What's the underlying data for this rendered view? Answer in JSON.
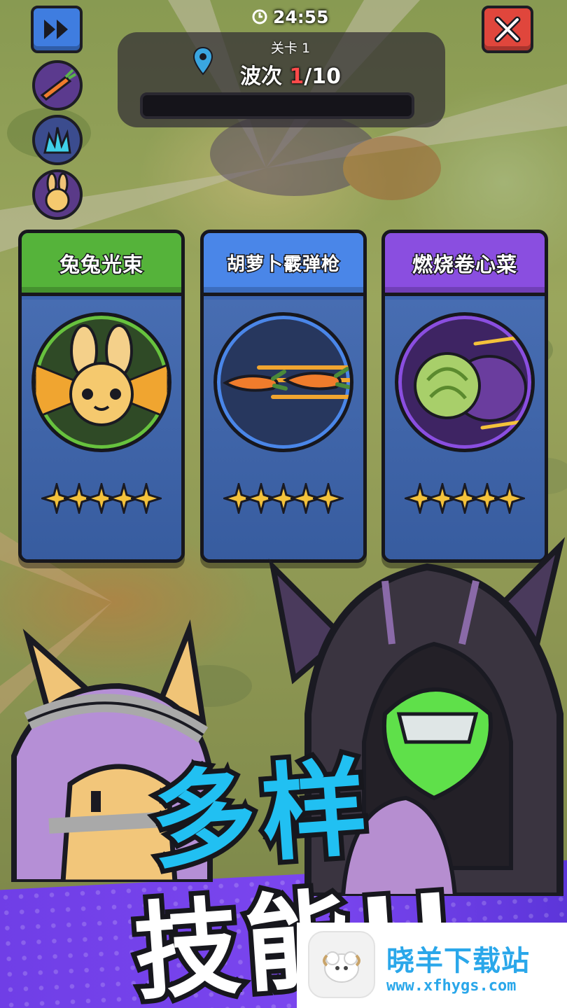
{
  "hud": {
    "timer": "24:55",
    "stage_label": "关卡 1",
    "wave_prefix": "波次 ",
    "wave_current": "1",
    "wave_total": "/10",
    "wave_progress": 0.0
  },
  "side_skills": [
    "carrot-slash-icon",
    "blue-flame-icon",
    "bunny-beam-icon"
  ],
  "cards": [
    {
      "title": "兔兔光束",
      "icon": "bunny-beam-icon",
      "stars": 5,
      "theme": "#55b33a"
    },
    {
      "title": "胡萝卜霰弹枪",
      "icon": "carrot-shotgun-icon",
      "stars": 5,
      "theme": "#4a86e8"
    },
    {
      "title": "燃烧卷心菜",
      "icon": "burning-cabbage-icon",
      "stars": 5,
      "theme": "#8a4ee0"
    }
  ],
  "promo": {
    "line1": "多样",
    "line2": "技能!!"
  },
  "watermark": {
    "name": "晓羊下载站",
    "url": "www.xfhygs.com"
  },
  "colors": {
    "promo_blue": "#21c0f2",
    "banner_purple": "#7b46ef",
    "close_red": "#e0463c",
    "ff_blue": "#3f7de0",
    "watermark_blue": "#2aa7ea"
  }
}
